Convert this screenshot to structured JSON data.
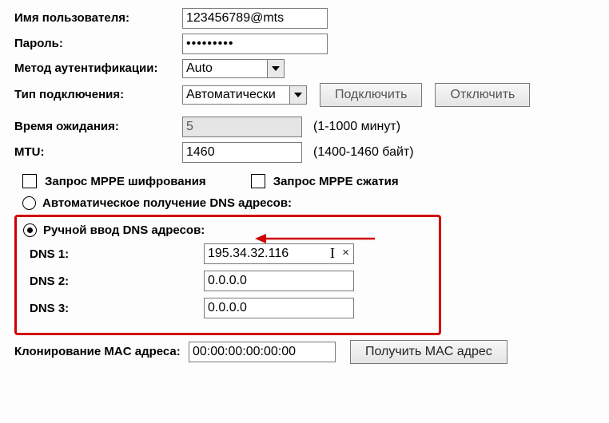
{
  "username": {
    "label": "Имя пользователя:",
    "value": "123456789@mts"
  },
  "password": {
    "label": "Пароль:",
    "value": "•••••••••"
  },
  "auth": {
    "label": "Метод аутентификации:",
    "value": "Auto"
  },
  "conn": {
    "label": "Тип подключения:",
    "value": "Автоматически",
    "connect": "Подключить",
    "disconnect": "Отключить"
  },
  "timeout": {
    "label": "Время ожидания:",
    "value": "5",
    "hint": "(1-1000 минут)"
  },
  "mtu": {
    "label": "MTU:",
    "value": "1460",
    "hint": "(1400-1460 байт)"
  },
  "mppe": {
    "enc": "Запрос MPPE шифрования",
    "comp": "Запрос MPPE сжатия"
  },
  "dns_mode": {
    "auto": "Автоматическое получение DNS адресов:",
    "manual": "Ручной ввод DNS адресов:"
  },
  "dns": [
    {
      "label": "DNS 1:",
      "value": "195.34.32.116"
    },
    {
      "label": "DNS 2:",
      "value": "0.0.0.0"
    },
    {
      "label": "DNS 3:",
      "value": "0.0.0.0"
    }
  ],
  "mac": {
    "label": "Клонирование MAC адреса:",
    "value": "00:00:00:00:00:00",
    "button": "Получить MAC адрес"
  }
}
